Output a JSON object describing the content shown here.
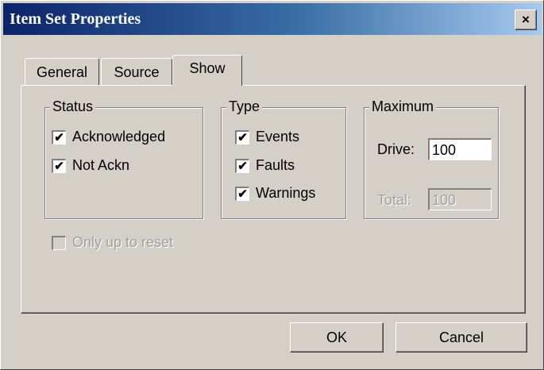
{
  "window": {
    "title": "Item Set Properties",
    "close_symbol": "×",
    "title_gradient": [
      "#0a246a",
      "#a6caf0"
    ]
  },
  "tabs": [
    {
      "label": "General",
      "active": false
    },
    {
      "label": "Source",
      "active": false
    },
    {
      "label": "Show",
      "active": true
    }
  ],
  "status_group": {
    "title": "Status",
    "items": [
      {
        "label": "Acknowledged",
        "checked": true
      },
      {
        "label": "Not Ackn",
        "checked": true
      }
    ]
  },
  "type_group": {
    "title": "Type",
    "items": [
      {
        "label": "Events",
        "checked": true
      },
      {
        "label": "Faults",
        "checked": true
      },
      {
        "label": "Warnings",
        "checked": true
      }
    ]
  },
  "maximum_group": {
    "title": "Maximum",
    "drive_label": "Drive:",
    "drive_value": "100",
    "total_label": "Total:",
    "total_value": "100",
    "total_enabled": false
  },
  "only_up_to_reset": {
    "label": "Only up to reset",
    "checked": false,
    "enabled": false
  },
  "buttons": {
    "ok": "OK",
    "cancel": "Cancel"
  },
  "check_mark": "✔"
}
